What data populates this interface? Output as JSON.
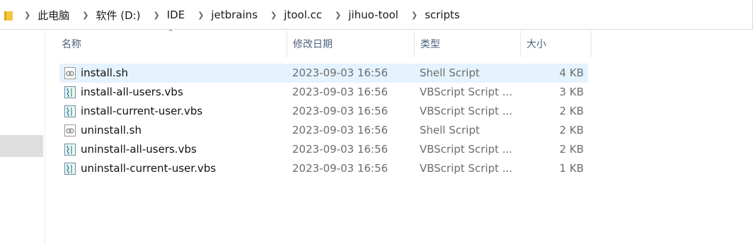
{
  "breadcrumb": [
    "此电脑",
    "软件 (D:)",
    "IDE",
    "jetbrains",
    "jtool.cc",
    "jihuo-tool",
    "scripts"
  ],
  "columns": {
    "name": "名称",
    "date": "修改日期",
    "type": "类型",
    "size": "大小"
  },
  "files": [
    {
      "name": "install.sh",
      "date": "2023-09-03 16:56",
      "type": "Shell Script",
      "size": "4 KB",
      "icon": "shell-script-icon",
      "selected": true
    },
    {
      "name": "install-all-users.vbs",
      "date": "2023-09-03 16:56",
      "type": "VBScript Script ...",
      "size": "3 KB",
      "icon": "vbscript-icon",
      "selected": false
    },
    {
      "name": "install-current-user.vbs",
      "date": "2023-09-03 16:56",
      "type": "VBScript Script ...",
      "size": "2 KB",
      "icon": "vbscript-icon",
      "selected": false
    },
    {
      "name": "uninstall.sh",
      "date": "2023-09-03 16:56",
      "type": "Shell Script",
      "size": "2 KB",
      "icon": "shell-script-icon",
      "selected": false
    },
    {
      "name": "uninstall-all-users.vbs",
      "date": "2023-09-03 16:56",
      "type": "VBScript Script ...",
      "size": "2 KB",
      "icon": "vbscript-icon",
      "selected": false
    },
    {
      "name": "uninstall-current-user.vbs",
      "date": "2023-09-03 16:56",
      "type": "VBScript Script ...",
      "size": "1 KB",
      "icon": "vbscript-icon",
      "selected": false
    }
  ],
  "colors": {
    "selection": "#e5f3ff",
    "header_text": "#4c607a",
    "folder": "#f5c542"
  }
}
